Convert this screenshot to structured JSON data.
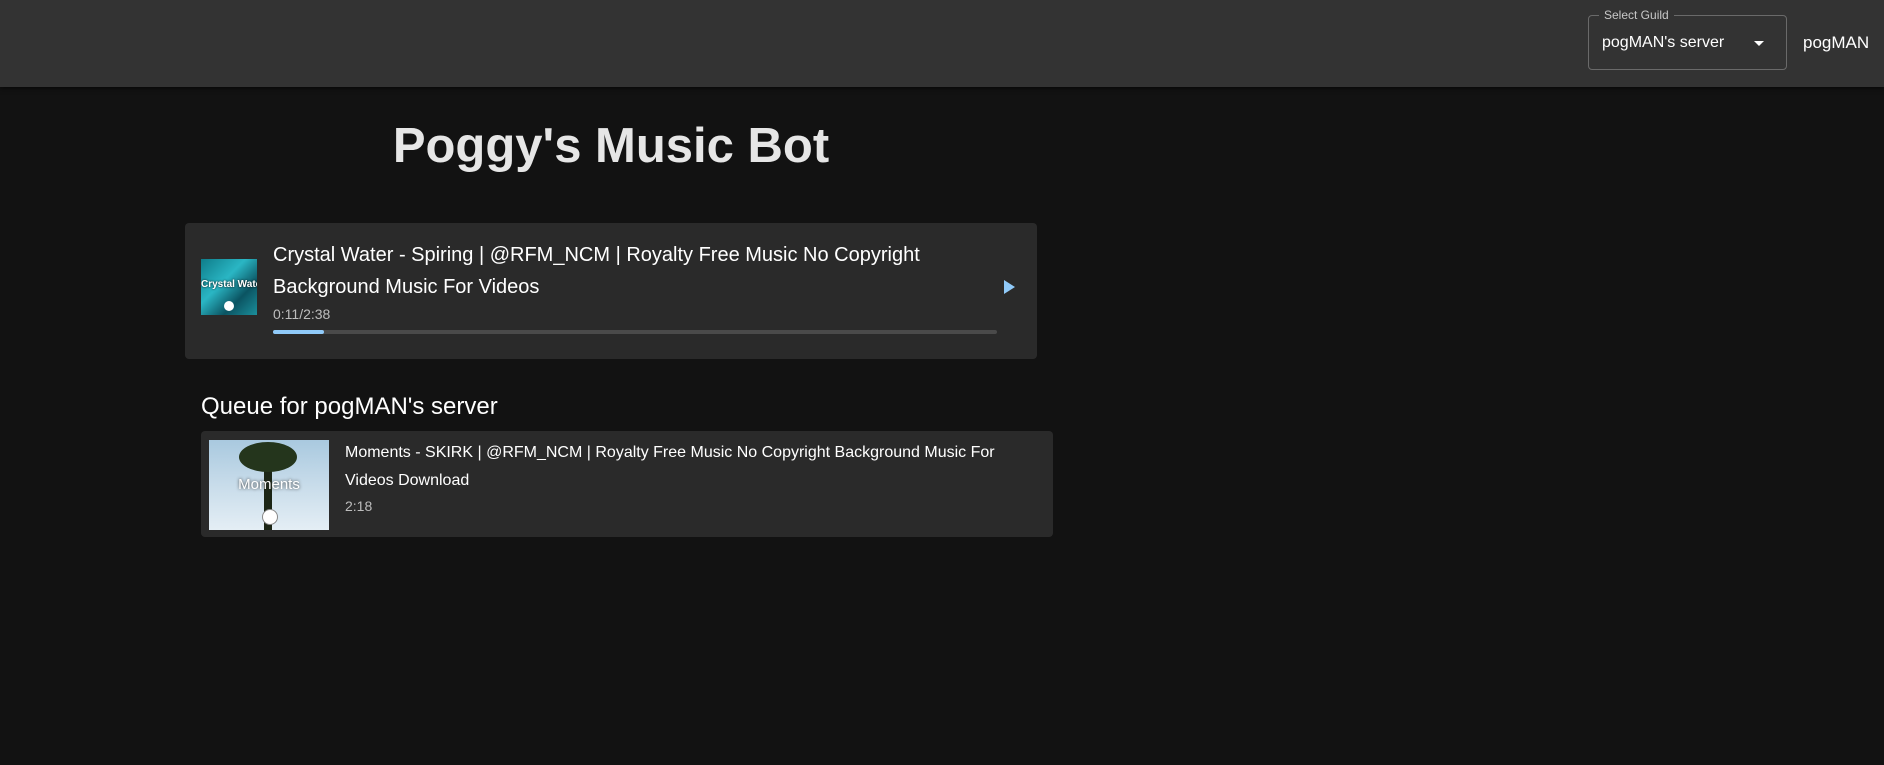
{
  "header": {
    "guild_select": {
      "label": "Select Guild",
      "value": "pogMAN's server"
    },
    "username": "pogMAN"
  },
  "main": {
    "title": "Poggy's Music Bot",
    "now_playing": {
      "title": "Crystal Water - Spiring | @RFM_NCM | Royalty Free Music No Copyright Background Music For Videos",
      "thumbnail_text": "Crystal Water",
      "time": "0:11/2:38",
      "progress": 0.07
    },
    "queue": {
      "heading": "Queue for pogMAN's server",
      "items": [
        {
          "title": "Moments - SKIRK | @RFM_NCM | Royalty Free Music No Copyright Background Music For Videos Download",
          "thumbnail_text": "Moments",
          "duration": "2:18"
        }
      ]
    }
  },
  "colors": {
    "background": "#121212",
    "appbar": "#333333",
    "card": "#2a2a2a",
    "accent": "#90caf9"
  }
}
